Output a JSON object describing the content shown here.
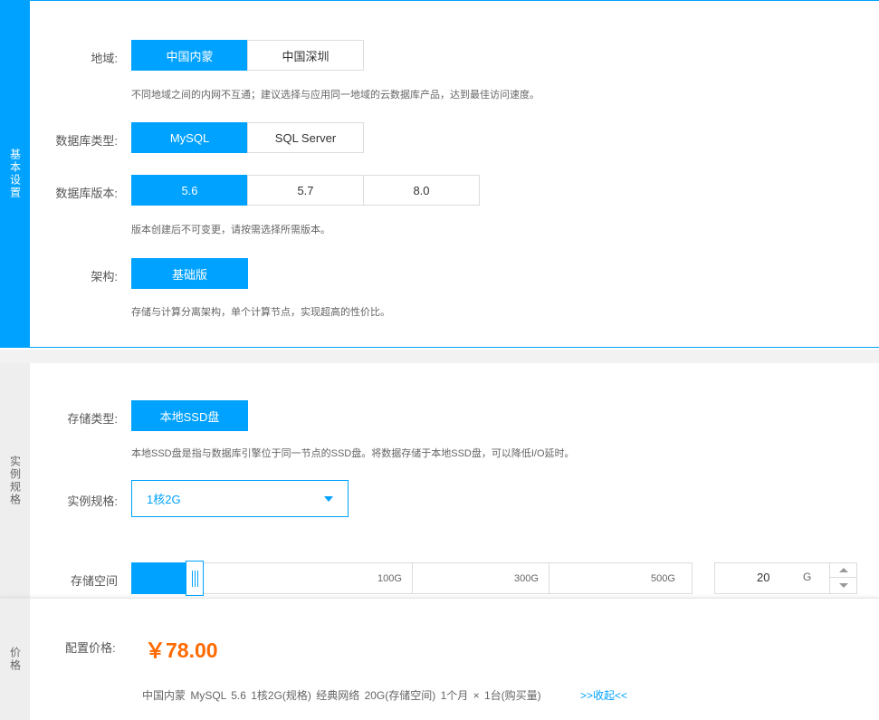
{
  "basic": {
    "tab_label": "基本设置",
    "region": {
      "label": "地域:",
      "options": [
        "中国内蒙",
        "中国深圳"
      ],
      "hint": "不同地域之间的内网不互通；建议选择与应用同一地域的云数据库产品，达到最佳访问速度。"
    },
    "db_type": {
      "label": "数据库类型:",
      "options": [
        "MySQL",
        "SQL Server"
      ]
    },
    "db_version": {
      "label": "数据库版本:",
      "options": [
        "5.6",
        "5.7",
        "8.0"
      ],
      "hint": "版本创建后不可变更，请按需选择所需版本。"
    },
    "arch": {
      "label": "架构:",
      "options": [
        "基础版"
      ],
      "hint": "存储与计算分离架构，单个计算节点，实现超高的性价比。"
    }
  },
  "spec": {
    "tab_label": "实例规格",
    "storage_type": {
      "label": "存储类型:",
      "options": [
        "本地SSD盘"
      ],
      "hint": "本地SSD盘是指与数据库引擎位于同一节点的SSD盘。将数据存储于本地SSD盘，可以降低I/O延时。"
    },
    "instance_spec": {
      "label": "实例规格:",
      "value": "1核2G"
    },
    "storage_space": {
      "label": "存储空间",
      "ticks": [
        "100G",
        "300G",
        "500G"
      ],
      "value": "20",
      "unit": "G"
    }
  },
  "price": {
    "tab_label": "价格",
    "label": "配置价格:",
    "amount": "￥78.00",
    "summary": "中国内蒙  MySQL  5.6  1核2G(规格)  经典网络  20G(存储空间)  1个月 × 1台(购买量)",
    "collapse_label": ">>收起<<"
  },
  "colors": {
    "accent": "#00a2ff",
    "price": "#ff6a00"
  }
}
